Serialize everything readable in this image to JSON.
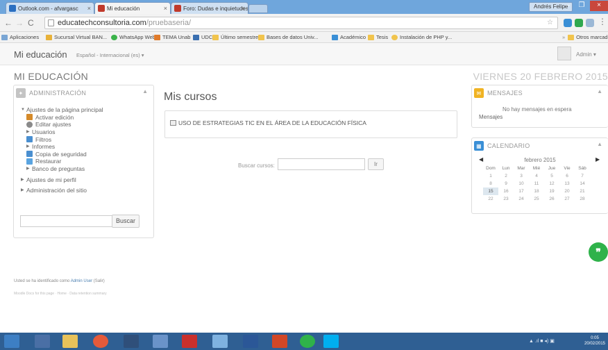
{
  "browser": {
    "tabs": [
      {
        "label": "Outlook.com - afvargasc",
        "color": "#2a6fc1"
      },
      {
        "label": "Mi educación",
        "color": "#c0392b"
      },
      {
        "label": "Foro: Dudas e inquietudes",
        "color": "#c0392b"
      }
    ],
    "user_chip": "Andrés Felipe",
    "url_domain": "educatechconsultoria.com",
    "url_path": "/pruebaseria/",
    "bookmarks": [
      "Aplicaciones",
      "Sucursal Virtual BAN...",
      "WhatsApp Web",
      "TEMA Unab",
      "UDC",
      "Último semestre",
      "Bases de datos Univ...",
      "Académico",
      "Tesis",
      "Instalación de PHP y...",
      "Otros marcadores"
    ]
  },
  "moodle": {
    "site_name": "Mi educación",
    "language": "Español - Internacional (es) ▾",
    "user_menu": "Admin ▾",
    "page_heading": "MI EDUCACIÓN",
    "date": "VIERNES 20 FEBRERO 2015"
  },
  "admin_block": {
    "title": "ADMINISTRACIÓN",
    "items": [
      {
        "label": "Ajustes de la página principal",
        "type": "section"
      },
      {
        "label": "Activar edición",
        "type": "child"
      },
      {
        "label": "Editar ajustes",
        "type": "child"
      },
      {
        "label": "Usuarios",
        "type": "child-folder"
      },
      {
        "label": "Filtros",
        "type": "child"
      },
      {
        "label": "Informes",
        "type": "child-folder"
      },
      {
        "label": "Copia de seguridad",
        "type": "child"
      },
      {
        "label": "Restaurar",
        "type": "child"
      },
      {
        "label": "Banco de preguntas",
        "type": "child-folder"
      },
      {
        "label": "Ajustes de mi perfil",
        "type": "section"
      },
      {
        "label": "Administración del sitio",
        "type": "section"
      }
    ],
    "search_button": "Buscar"
  },
  "main": {
    "title": "Mis cursos",
    "course": "USO DE ESTRATEGIAS TIC EN EL ÁREA DE LA EDUCACIÓN FÍSICA",
    "search_label": "Buscar cursos:",
    "search_button": "Ir"
  },
  "messages_block": {
    "title": "MENSAJES",
    "empty_text": "No hay mensajes en espera",
    "link": "Mensajes"
  },
  "calendar_block": {
    "title": "CALENDARIO",
    "month": "febrero 2015",
    "weekdays": [
      "Dom",
      "Lun",
      "Mar",
      "Mié",
      "Jue",
      "Vie",
      "Sáb"
    ],
    "weeks": [
      [
        "1",
        "2",
        "3",
        "4",
        "5",
        "6",
        "7"
      ],
      [
        "8",
        "9",
        "10",
        "11",
        "12",
        "13",
        "14"
      ],
      [
        "15",
        "16",
        "17",
        "18",
        "19",
        "20",
        "21"
      ],
      [
        "22",
        "23",
        "24",
        "25",
        "26",
        "27",
        "28"
      ]
    ],
    "today": "15"
  },
  "footer": {
    "login_prefix": "Usted se ha identificado como ",
    "login_user": "Admin User",
    "login_suffix": " (Salir)",
    "tiny": "Moodle Docs for this page · Home · Data retention summary"
  },
  "taskbar": {
    "tray_text": "▲ .ıl ■ ◂) ▣",
    "time": "0:05",
    "date": "20/02/2015"
  }
}
